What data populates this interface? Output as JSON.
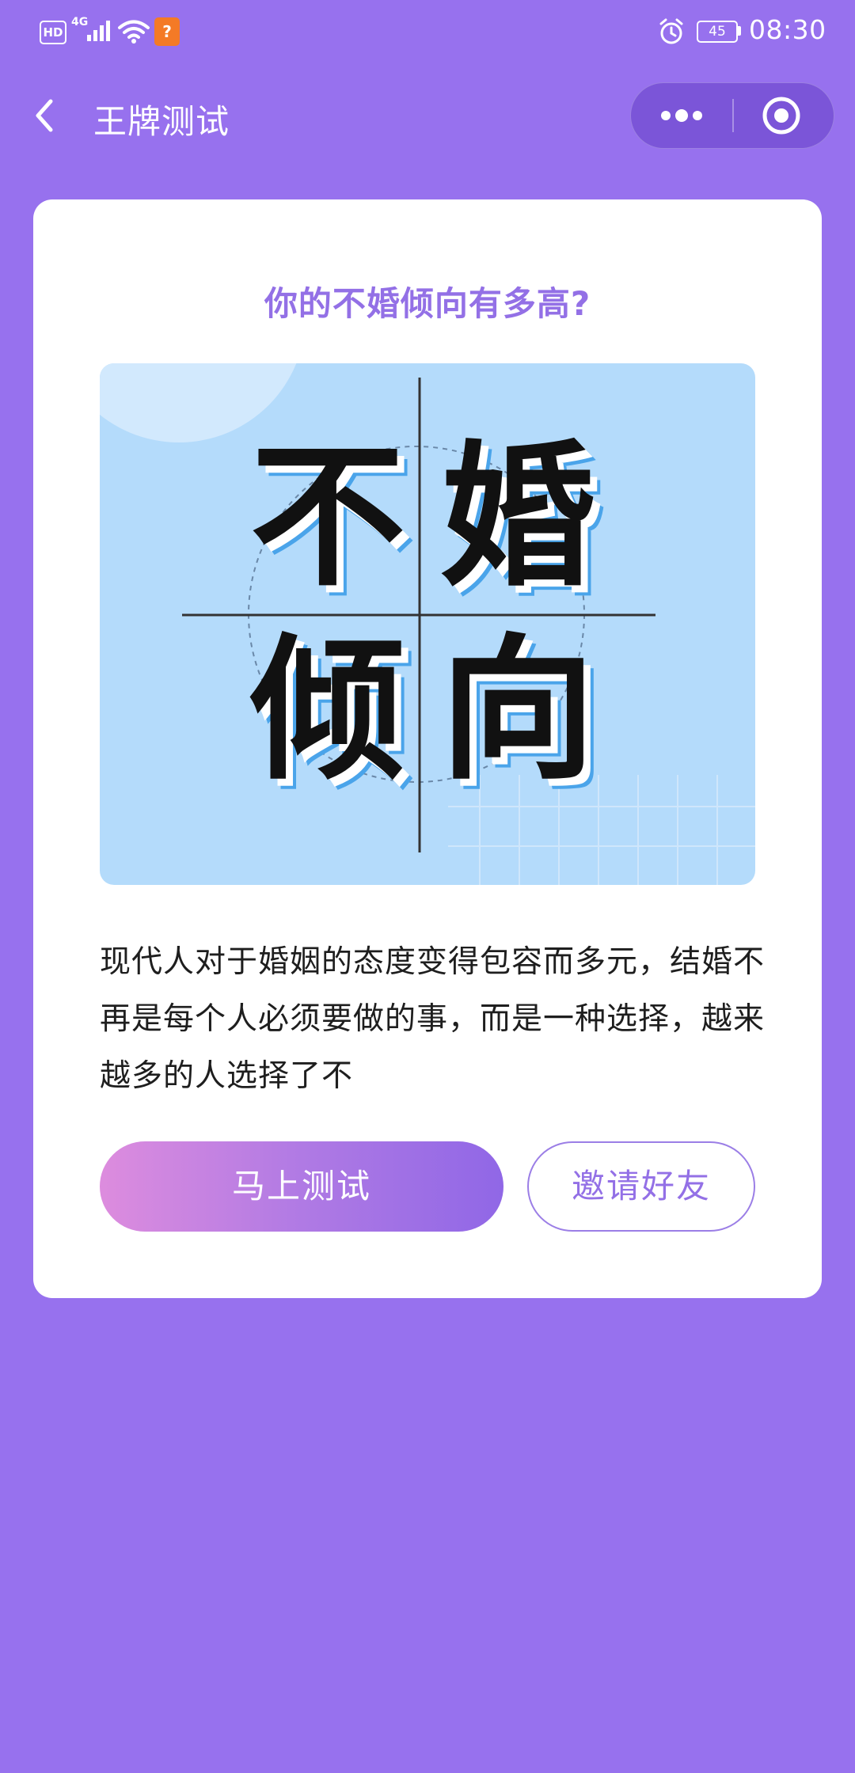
{
  "status_bar": {
    "hd_label": "HD",
    "network_label": "4G",
    "battery_level": "45",
    "time": "08:30",
    "app_badge_glyph": "?",
    "icons": [
      "signal-icon",
      "wifi-icon",
      "alarm-icon",
      "battery-icon"
    ]
  },
  "nav": {
    "title": "王牌测试",
    "back_icon": "chevron-left-icon",
    "more_icon": "more-dots-icon",
    "close_icon": "target-close-icon"
  },
  "card": {
    "title": "你的不婚倾向有多高?",
    "cover_chars": [
      "不",
      "婚",
      "倾",
      "向"
    ],
    "description": "现代人对于婚姻的态度变得包容而多元，结婚不再是每个人必须要做的事，而是一种选择，越来越多的人选择了不",
    "start_label": "马上测试",
    "invite_label": "邀请好友"
  },
  "colors": {
    "background": "#9771ee",
    "title": "#9370e6",
    "cover_bg": "#b4dbfb",
    "cover_shadow": "#4aa4ea",
    "button_gradient_start": "#dd8cde",
    "button_gradient_end": "#9067e6"
  }
}
